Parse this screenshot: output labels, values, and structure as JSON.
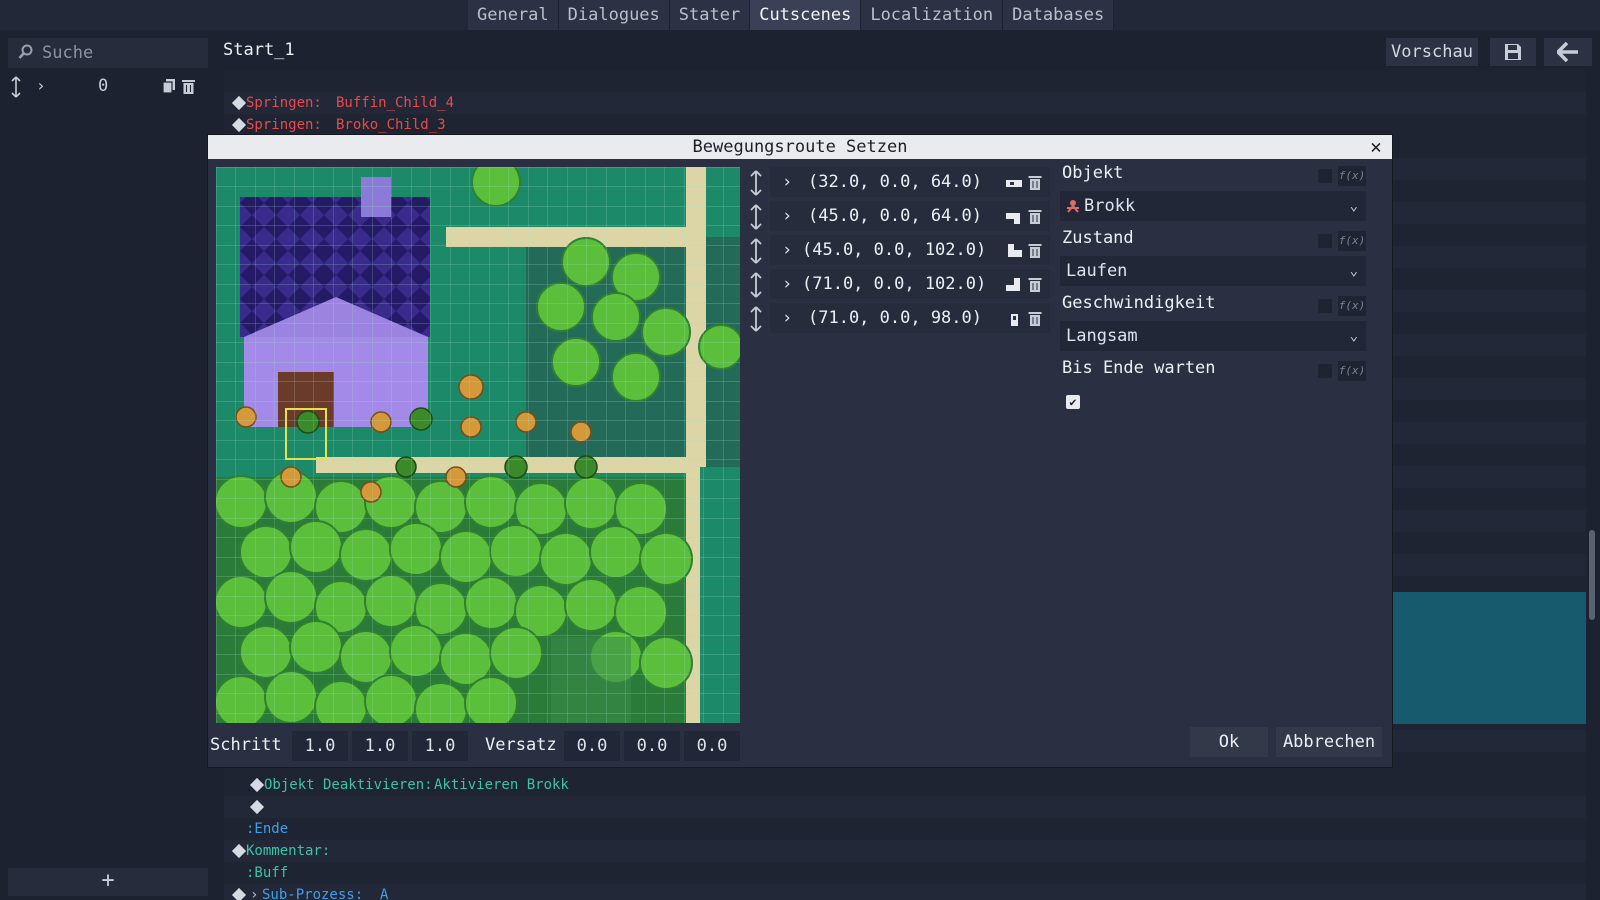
{
  "tabs": [
    {
      "label": "General",
      "active": false
    },
    {
      "label": "Dialogues",
      "active": false
    },
    {
      "label": "Stater",
      "active": false
    },
    {
      "label": "Cutscenes",
      "active": true
    },
    {
      "label": "Localization",
      "active": false
    },
    {
      "label": "Databases",
      "active": false
    }
  ],
  "left": {
    "search_placeholder": "Suche",
    "row_value": "0",
    "add_label": "+"
  },
  "main": {
    "title": "Start_1",
    "preview_label": "Vorschau"
  },
  "script": {
    "rows": [
      {
        "kind": "Springen:",
        "text": "Buffin_Child_4",
        "color": "red"
      },
      {
        "kind": "Springen:",
        "text": "Broko_Child_3",
        "color": "red"
      },
      {
        "kind": "Objekt Deaktivieren:",
        "text": "Aktivieren Brokk",
        "color": "teal"
      },
      {
        "kind": "",
        "text": "",
        "color": "gray"
      },
      {
        "kind": ":Ende",
        "text": "",
        "color": "blue"
      },
      {
        "kind": "Kommentar:",
        "text": "",
        "color": "teal"
      },
      {
        "kind": ":Buff",
        "text": "",
        "color": "teal"
      },
      {
        "kind": "Sub-Prozess:",
        "text": "A",
        "color": "blue"
      }
    ]
  },
  "modal": {
    "title": "Bewegungsroute Setzen",
    "close": "✕",
    "waypoints": [
      {
        "coord": "(32.0, 0.0, 64.0)",
        "icon": "road-start-icon"
      },
      {
        "coord": "(45.0, 0.0, 64.0)",
        "icon": "road-corner-icon"
      },
      {
        "coord": "(45.0, 0.0, 102.0)",
        "icon": "road-corner-icon"
      },
      {
        "coord": "(71.0, 0.0, 102.0)",
        "icon": "road-corner-icon"
      },
      {
        "coord": "(71.0, 0.0, 98.0)",
        "icon": "road-end-icon"
      }
    ],
    "step_label": "Schritt",
    "step_values": [
      "1.0",
      "1.0",
      "1.0"
    ],
    "offset_label": "Versatz",
    "offset_values": [
      "0.0",
      "0.0",
      "0.0"
    ],
    "props": {
      "object_label": "Objekt",
      "object_value": "Brokk",
      "state_label": "Zustand",
      "state_value": "Laufen",
      "speed_label": "Geschwindigkeit",
      "speed_value": "Langsam",
      "wait_label": "Bis Ende warten",
      "wait_checked": true,
      "fx_label": "f(x)"
    },
    "ok_label": "Ok",
    "cancel_label": "Abbrechen"
  },
  "colors": {
    "accent_red": "#e84a4a",
    "accent_teal": "#3cc2a8",
    "highlight": "#175a6e"
  }
}
